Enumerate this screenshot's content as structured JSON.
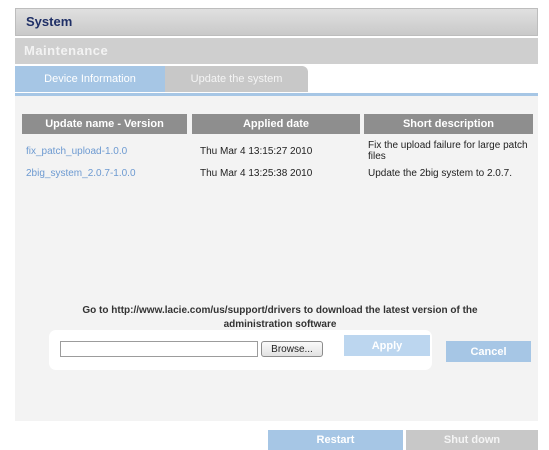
{
  "header": {
    "system_title": "System",
    "maintenance_title": "Maintenance"
  },
  "tabs": [
    {
      "label": "Device Information"
    },
    {
      "label": "Update the system"
    }
  ],
  "table": {
    "columns": [
      "Update name - Version",
      "Applied date",
      "Short description"
    ],
    "rows": [
      {
        "name": "fix_patch_upload-1.0.0",
        "date": "Thu Mar 4 13:15:27 2010",
        "description": "Fix the upload failure for large patch files"
      },
      {
        "name": "2big_system_2.0.7-1.0.0",
        "date": "Thu Mar 4 13:25:38 2010",
        "description": "Update the 2big system to 2.0.7."
      }
    ]
  },
  "download_info": {
    "line1": "Go to http://www.lacie.com/us/support/drivers to download the latest version of the",
    "line2": "administration software"
  },
  "upload": {
    "file_value": "",
    "browse_label": "Browse...",
    "apply_label": "Apply",
    "cancel_label": "Cancel"
  },
  "footer": {
    "restart_label": "Restart",
    "shutdown_label": "Shut down"
  },
  "colors": {
    "accent": "#a6c6e5",
    "title_text": "#1f2f66",
    "link": "#6d9ad1",
    "table_header": "#8e8e8e"
  }
}
